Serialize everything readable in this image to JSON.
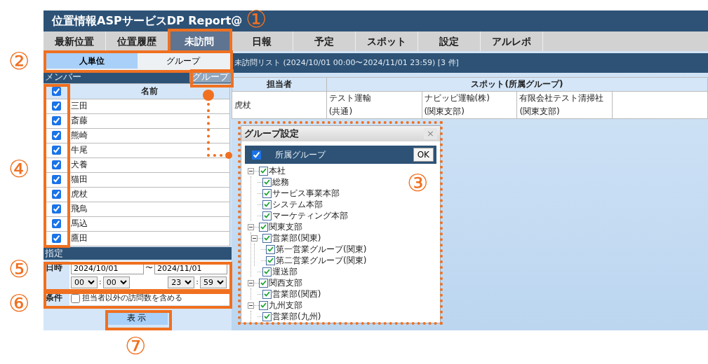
{
  "window": {
    "title": "位置情報ASPサービスDP Report@"
  },
  "nav_tabs": [
    {
      "label": "最新位置",
      "selected": false
    },
    {
      "label": "位置履歴",
      "selected": false
    },
    {
      "label": "未訪問",
      "selected": true
    },
    {
      "label": "日報",
      "selected": false
    },
    {
      "label": "予定",
      "selected": false
    },
    {
      "label": "スポット",
      "selected": false
    },
    {
      "label": "設定",
      "selected": false
    },
    {
      "label": "アルレポ",
      "selected": false
    }
  ],
  "left_panel": {
    "mode_tabs": [
      {
        "label": "人単位",
        "selected": true
      },
      {
        "label": "グループ",
        "selected": false
      }
    ],
    "members_bar": {
      "label": "メンバー",
      "group_button": "グループ"
    },
    "members_table": {
      "all_checked": true,
      "column": "名前",
      "rows": [
        {
          "name": "三田",
          "checked": true
        },
        {
          "name": "斎藤",
          "checked": true
        },
        {
          "name": "熊崎",
          "checked": true
        },
        {
          "name": "牛尾",
          "checked": true
        },
        {
          "name": "犬養",
          "checked": true
        },
        {
          "name": "猫田",
          "checked": true
        },
        {
          "name": "虎杖",
          "checked": true
        },
        {
          "name": "飛鳥",
          "checked": true
        },
        {
          "name": "馬込",
          "checked": true
        },
        {
          "name": "鷹田",
          "checked": true
        }
      ]
    },
    "settings": {
      "title": "指定",
      "datetime_label": "日時",
      "start_date": "2024/10/01",
      "separator": "〜",
      "end_date": "2024/11/01",
      "start_hour": "00",
      "start_minute": "00",
      "end_hour": "23",
      "end_minute": "59",
      "colon_1": ":",
      "colon_2": ":",
      "condition_label": "条件",
      "condition_option": {
        "label": "担当者以外の訪問数を含める",
        "checked": false
      }
    },
    "show_button": "表示"
  },
  "list": {
    "title": "未訪問リスト (2024/10/01 00:00〜2024/11/01 23:59) [3 件]",
    "columns": [
      "担当者",
      "スポット(所属グループ)"
    ],
    "rows": [
      {
        "person": "虎杖",
        "spots": [
          {
            "name": "テスト運輸",
            "group": "(共通)"
          },
          {
            "name": "ナビッピ運輸(株)",
            "group": "(関東支部)"
          },
          {
            "name": "有限会社テスト清掃社",
            "group": "(関東支部)"
          }
        ]
      }
    ]
  },
  "dialog": {
    "title": "グループ設定",
    "close": "×",
    "header_checked": true,
    "header_label": "所属グループ",
    "ok_button": "OK",
    "tree": [
      {
        "label": "本社",
        "checked": true,
        "expanded": true,
        "children": [
          {
            "label": "総務",
            "checked": true
          },
          {
            "label": "サービス事業本部",
            "checked": true
          },
          {
            "label": "システム本部",
            "checked": true
          },
          {
            "label": "マーケティング本部",
            "checked": true
          }
        ]
      },
      {
        "label": "関東支部",
        "checked": true,
        "expanded": true,
        "children": [
          {
            "label": "営業部(関東)",
            "checked": true,
            "expanded": true,
            "children": [
              {
                "label": "第一営業グループ(関東)",
                "checked": true
              },
              {
                "label": "第二営業グループ(関東)",
                "checked": true
              }
            ]
          },
          {
            "label": "運送部",
            "checked": true
          }
        ]
      },
      {
        "label": "関西支部",
        "checked": true,
        "expanded": true,
        "children": [
          {
            "label": "営業部(関西)",
            "checked": true
          }
        ]
      },
      {
        "label": "九州支部",
        "checked": true,
        "expanded": true,
        "children": [
          {
            "label": "営業部(九州)",
            "checked": true
          }
        ]
      }
    ]
  },
  "annotations": [
    "①",
    "②",
    "③",
    "④",
    "⑤",
    "⑥",
    "⑦"
  ]
}
